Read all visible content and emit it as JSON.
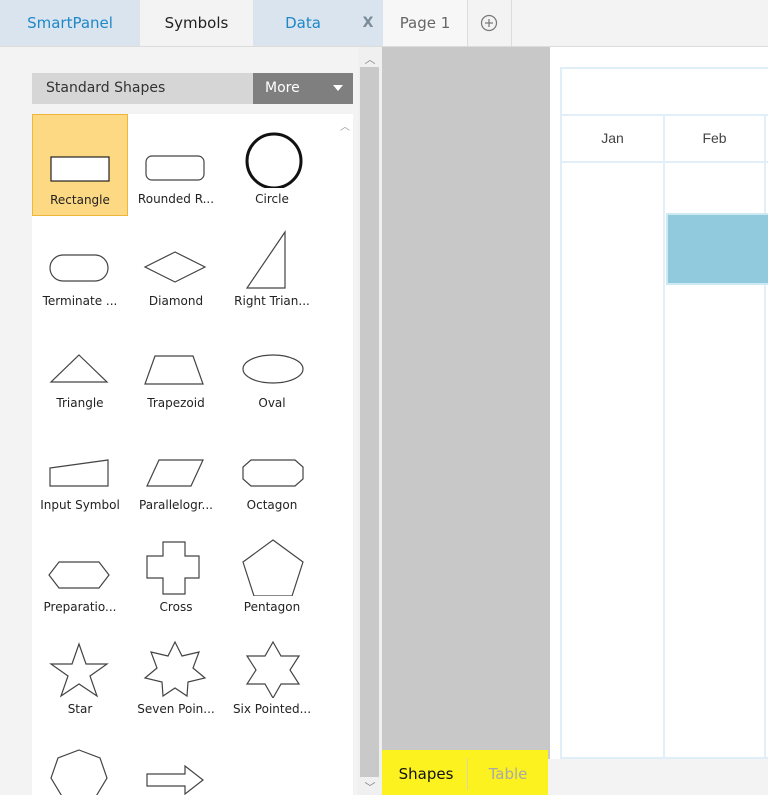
{
  "top_tabs": {
    "smartpanel": "SmartPanel",
    "symbols": "Symbols",
    "data": "Data",
    "close": "X",
    "page": "Page 1"
  },
  "library": {
    "title": "Standard Shapes",
    "more": "More"
  },
  "shapes": [
    {
      "label": "Rectangle",
      "icon": "rectangle-icon",
      "selected": true
    },
    {
      "label": "Rounded R...",
      "icon": "rounded-rectangle-icon"
    },
    {
      "label": "Circle",
      "icon": "circle-icon"
    },
    {
      "label": "Terminate ...",
      "icon": "terminator-icon"
    },
    {
      "label": "Diamond",
      "icon": "diamond-icon"
    },
    {
      "label": "Right Trian...",
      "icon": "right-triangle-icon"
    },
    {
      "label": "Triangle",
      "icon": "triangle-icon"
    },
    {
      "label": "Trapezoid",
      "icon": "trapezoid-icon"
    },
    {
      "label": "Oval",
      "icon": "oval-icon"
    },
    {
      "label": "Input Symbol",
      "icon": "input-symbol-icon"
    },
    {
      "label": "Parallelogr...",
      "icon": "parallelogram-icon"
    },
    {
      "label": "Octagon",
      "icon": "octagon-icon"
    },
    {
      "label": "Preparatio...",
      "icon": "preparation-icon"
    },
    {
      "label": "Cross",
      "icon": "cross-icon"
    },
    {
      "label": "Pentagon",
      "icon": "pentagon-icon"
    },
    {
      "label": "Star",
      "icon": "star-icon"
    },
    {
      "label": "Seven Poin...",
      "icon": "seven-point-star-icon"
    },
    {
      "label": "Six Pointed...",
      "icon": "six-point-star-icon"
    },
    {
      "label": "",
      "icon": "heptagon-icon"
    },
    {
      "label": "",
      "icon": "arrow-right-icon"
    }
  ],
  "canvas": {
    "months": [
      "Jan",
      "Feb"
    ]
  },
  "bottom_tabs": {
    "shapes": "Shapes",
    "table": "Table"
  },
  "colors": {
    "accent_blue": "#1e88c8",
    "selected_fill": "#fdd983",
    "bar_fill": "#92cadd",
    "highlight": "#fbf220"
  }
}
